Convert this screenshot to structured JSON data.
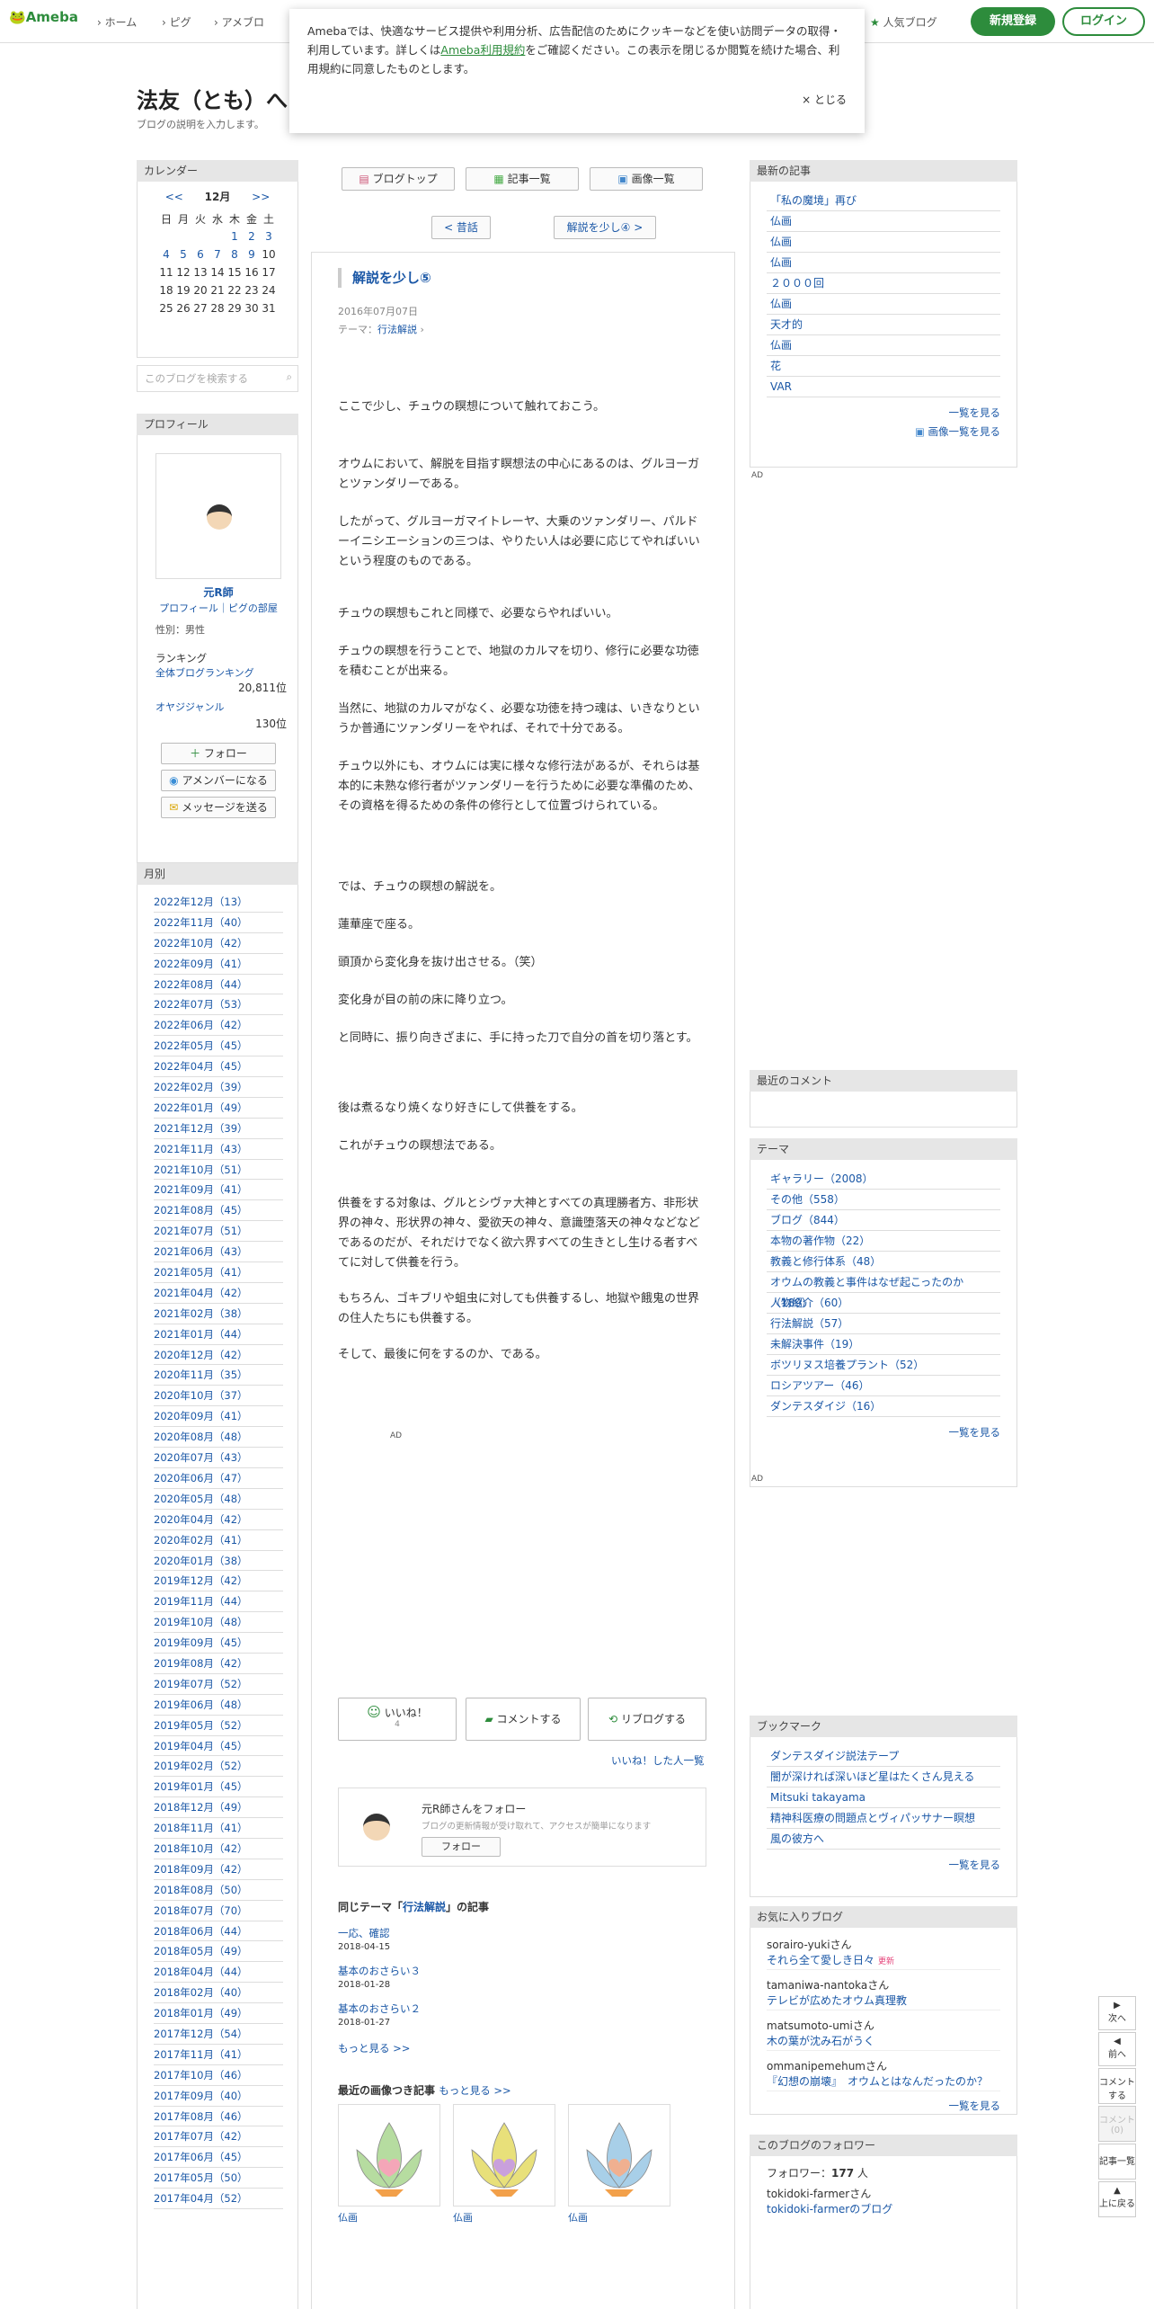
{
  "header": {
    "logo": "Ameba",
    "nav": [
      "ホーム",
      "ピグ",
      "アメブロ"
    ],
    "popular": "人気ブログ",
    "register": "新規登録",
    "login": "ログイン"
  },
  "cookie": {
    "text1": "Amebaでは、快適なサービス提供や利用分析、広告配信のためにクッキーなどを使い訪問データの取得・利用しています。詳しくは",
    "link": "Ameba利用規約",
    "text2": "をご確認ください。この表示を閉じるか閲覧を続けた場合、利用規約に同意したものとします。",
    "close": "× とじる"
  },
  "blog": {
    "title": "法友（とも）へ",
    "desc": "ブログの説明を入力します。"
  },
  "calendar": {
    "header": "カレンダー",
    "prev": "<<",
    "month": "12月",
    "next": ">>",
    "weekdays": [
      "日",
      "月",
      "火",
      "水",
      "木",
      "金",
      "土"
    ],
    "rows": [
      [
        "",
        "",
        "",
        "",
        "1",
        "2",
        "3"
      ],
      [
        "4",
        "5",
        "6",
        "7",
        "8",
        "9",
        "10"
      ],
      [
        "11",
        "12",
        "13",
        "14",
        "15",
        "16",
        "17"
      ],
      [
        "18",
        "19",
        "20",
        "21",
        "22",
        "23",
        "24"
      ],
      [
        "25",
        "26",
        "27",
        "28",
        "29",
        "30",
        "31"
      ]
    ],
    "linked": [
      "1",
      "2",
      "3",
      "4",
      "5",
      "6",
      "7",
      "8",
      "9"
    ]
  },
  "search": {
    "placeholder": "このブログを検索する"
  },
  "profile": {
    "header": "プロフィール",
    "name": "元R師",
    "links": "プロフィール｜ピグの部屋",
    "gender": "性別：男性",
    "ranking": "ランキング",
    "rank_all": "全体ブログランキング",
    "rank_all_val": "20,811位",
    "rank_genre": "オヤジジャンル",
    "rank_genre_val": "130位",
    "follow": "フォロー",
    "member": "アメンバーになる",
    "message": "メッセージを送る"
  },
  "monthly": {
    "header": "月別",
    "items": [
      "2022年12月（13）",
      "2022年11月（40）",
      "2022年10月（42）",
      "2022年09月（41）",
      "2022年08月（44）",
      "2022年07月（53）",
      "2022年06月（42）",
      "2022年05月（45）",
      "2022年04月（45）",
      "2022年02月（39）",
      "2022年01月（49）",
      "2021年12月（39）",
      "2021年11月（43）",
      "2021年10月（51）",
      "2021年09月（41）",
      "2021年08月（45）",
      "2021年07月（51）",
      "2021年06月（43）",
      "2021年05月（41）",
      "2021年04月（42）",
      "2021年02月（38）",
      "2021年01月（44）",
      "2020年12月（42）",
      "2020年11月（35）",
      "2020年10月（37）",
      "2020年09月（41）",
      "2020年08月（48）",
      "2020年07月（43）",
      "2020年06月（47）",
      "2020年05月（48）",
      "2020年04月（42）",
      "2020年02月（41）",
      "2020年01月（38）",
      "2019年12月（42）",
      "2019年11月（44）",
      "2019年10月（48）",
      "2019年09月（45）",
      "2019年08月（42）",
      "2019年07月（52）",
      "2019年06月（48）",
      "2019年05月（52）",
      "2019年04月（45）",
      "2019年02月（52）",
      "2019年01月（45）",
      "2018年12月（49）",
      "2018年11月（41）",
      "2018年10月（42）",
      "2018年09月（42）",
      "2018年08月（50）",
      "2018年07月（70）",
      "2018年06月（44）",
      "2018年05月（49）",
      "2018年04月（44）",
      "2018年02月（40）",
      "2018年01月（49）",
      "2017年12月（54）",
      "2017年11月（41）",
      "2017年10月（46）",
      "2017年09月（40）",
      "2017年08月（46）",
      "2017年07月（42）",
      "2017年06月（45）",
      "2017年05月（50）",
      "2017年04月（52）"
    ]
  },
  "topnav": {
    "top": "ブログトップ",
    "list": "記事一覧",
    "images": "画像一覧",
    "prev": "< 昔話",
    "next": "解説を少し④ >"
  },
  "article": {
    "title": "解説を少し⑤",
    "date": "2016年07月07日",
    "theme_label": "テーマ：",
    "theme": "行法解説",
    "paras": [
      "ここで少し、チュウの瞑想について触れておこう。",
      "オウムにおいて、解脱を目指す瞑想法の中心にあるのは、グルヨーガとツァンダリーである。",
      "したがって、グルヨーガマイトレーヤ、大乗のツァンダリー、パルドーイニシエーションの三つは、やりたい人は必要に応じてやればいいという程度のものである。",
      "チュウの瞑想もこれと同様で、必要ならやればいい。",
      "チュウの瞑想を行うことで、地獄のカルマを切り、修行に必要な功徳を積むことが出来る。",
      "当然に、地獄のカルマがなく、必要な功徳を持つ魂は、いきなりというか普通にツァンダリーをやれば、それで十分である。",
      "チュウ以外にも、オウムには実に様々な修行法があるが、それらは基本的に未熟な修行者がツァンダリーを行うために必要な準備のため、その資格を得るための条件の修行として位置づけられている。",
      "では、チュウの瞑想の解説を。",
      "蓮華座で座る。",
      "頭頂から変化身を抜け出させる。（笑）",
      "変化身が目の前の床に降り立つ。",
      "と同時に、振り向きざまに、手に持った刀で自分の首を切り落とす。",
      "後は煮るなり焼くなり好きにして供養をする。",
      "これがチュウの瞑想法である。",
      "供養をする対象は、グルとシヴァ大神とすべての真理勝者方、非形状界の神々、形状界の神々、愛欲天の神々、意識堕落天の神々などなどであるのだが、それだけでなく欲六界すべての生きとし生ける者すべてに対して供養を行う。",
      "もちろん、ゴキブリや蛆虫に対しても供養するし、地獄や餓鬼の世界の住人たちにも供養する。",
      "そして、最後に何をするのか、である。"
    ],
    "ad": "AD",
    "like": "いいね！",
    "like_count": "4",
    "comment": "コメントする",
    "reblog": "リブログする",
    "liked_list": "いいね！した人一覧",
    "follow_card_title": "元R師さんをフォロー",
    "follow_card_desc": "ブログの更新情報が受け取れて、アクセスが簡単になります",
    "follow_btn": "フォロー"
  },
  "same_theme": {
    "header_pre": "同じテーマ「",
    "theme": "行法解説",
    "header_post": "」の記事",
    "items": [
      {
        "title": "一応、確認",
        "date": "2018-04-15"
      },
      {
        "title": "基本のおさらい３",
        "date": "2018-01-28"
      },
      {
        "title": "基本のおさらい２",
        "date": "2018-01-27"
      }
    ],
    "more": "もっと見る >>"
  },
  "recent_images": {
    "header": "最近の画像つき記事",
    "more": "もっと見る >>",
    "items": [
      "仏画",
      "仏画",
      "仏画"
    ]
  },
  "recent": {
    "header": "最新の記事",
    "items": [
      "「私の魔境」再び",
      "仏画",
      "仏画",
      "仏画",
      "２０００回",
      "仏画",
      "天才的",
      "仏画",
      "花",
      "VAR"
    ],
    "more": "一覧を見る",
    "image_more": "画像一覧を見る"
  },
  "ad_label": "AD",
  "comments": {
    "header": "最近のコメント"
  },
  "themes": {
    "header": "テーマ",
    "items": [
      "ギャラリー（2008）",
      "その他（558）",
      "ブログ（844）",
      "本物の著作物（22）",
      "教義と修行体系（48）",
      "オウムの教義と事件はなぜ起こったのか（189）",
      "人物紹介（60）",
      "行法解説（57）",
      "未解決事件（19）",
      "ボツリヌス培養プラント（52）",
      "ロシアツアー（46）",
      "ダンテスダイジ（16）"
    ],
    "more": "一覧を見る"
  },
  "bookmarks": {
    "header": "ブックマーク",
    "items": [
      "ダンテスダイジ説法テープ",
      "闇が深ければ深いほど星はたくさん見える",
      "Mitsuki takayama",
      "精神科医療の問題点とヴィパッサナー瞑想",
      "風の彼方へ"
    ],
    "more": "一覧を見る"
  },
  "fav": {
    "header": "お気に入りブログ",
    "items": [
      {
        "user": "sorairo-yukiさん",
        "blog": "それら全て愛しき日々",
        "badge": "更新"
      },
      {
        "user": "tamaniwa-nantokaさん",
        "blog": "テレビが広めたオウム真理教",
        "badge": ""
      },
      {
        "user": "matsumoto-umiさん",
        "blog": "木の葉が沈み石がうく",
        "badge": ""
      },
      {
        "user": "ommanipemehumさん",
        "blog": "『幻想の崩壊』　オウムとはなんだったのか？",
        "badge": ""
      }
    ],
    "more": "一覧を見る"
  },
  "followers": {
    "header": "このブログのフォロワー",
    "count_label": "フォロワー：",
    "count": "177",
    "unit": "人",
    "user": "tokidoki-farmerさん",
    "blog": "tokidoki-farmerのブログ"
  },
  "float": {
    "next": "次へ",
    "prev": "前へ",
    "comment": "コメントする",
    "comment_dis": "コメント(0)",
    "list": "記事一覧",
    "top": "上に戻る"
  }
}
